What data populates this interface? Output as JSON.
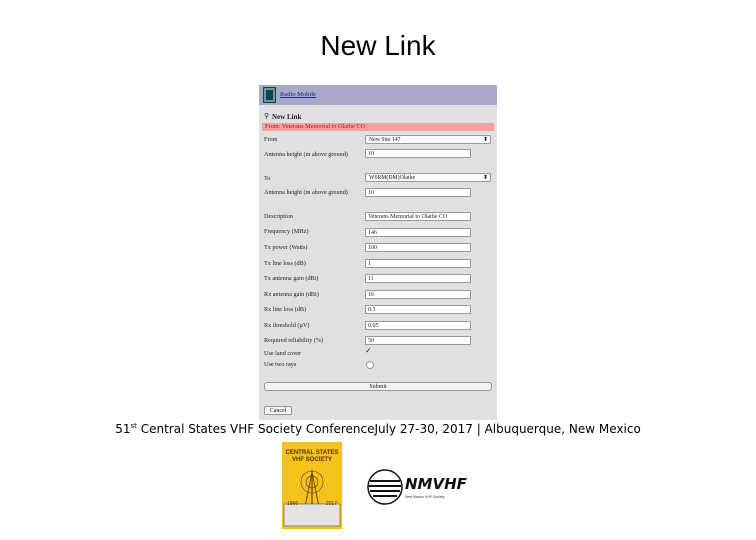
{
  "slide": {
    "title": "New Link",
    "footer_pre": "51",
    "footer_sup": "st",
    "footer_post": " Central States VHF Society ConferenceJuly 27-30, 2017 | Albuquerque, New Mexico"
  },
  "app": {
    "name": "Radio Mobile",
    "form_title": "New Link",
    "error_banner": "From: Veterans Memorial to Olathe CO",
    "from_label": "From",
    "from_value": "New Site 147",
    "from_antenna_label": "Antenna height (m above ground)",
    "from_antenna_value": "10",
    "to_label": "To",
    "to_value": "W6RM(DM)Olathe",
    "to_antenna_label": "Antenna height (m above ground)",
    "to_antenna_value": "10",
    "fields": [
      {
        "label": "Description",
        "value": "Veterans Memorial to Olathe CO"
      },
      {
        "label": "Frequency (MHz)",
        "value": "146"
      },
      {
        "label": "Tx power (Watts)",
        "value": "100"
      },
      {
        "label": "Tx line loss (dB)",
        "value": "1"
      },
      {
        "label": "Tx antenna gain (dBi)",
        "value": "11"
      },
      {
        "label": "Rx antenna gain (dBi)",
        "value": "16"
      },
      {
        "label": "Rx line loss (dB)",
        "value": "0.5"
      },
      {
        "label": "Rx threshold (µV)",
        "value": "0.05"
      },
      {
        "label": "Required reliability (%)",
        "value": "50"
      }
    ],
    "use_land_cover_label": "Use land cover",
    "use_two_rays_label": "Use two rays",
    "submit_label": "Submit",
    "cancel_label": "Cancel"
  },
  "logos": {
    "csvhf_line1": "CENTRAL STATES",
    "csvhf_line2": "VHF SOCIETY",
    "csvhf_year1": "1966",
    "csvhf_year2": "2017",
    "nmvhf_text": "NMVHF",
    "nmvhf_sub": "New Mexico VHF Society"
  },
  "colors": {
    "header": "#a8a8c8",
    "banner": "#f3a0a0",
    "csvhf_gold": "#f3c21c"
  }
}
